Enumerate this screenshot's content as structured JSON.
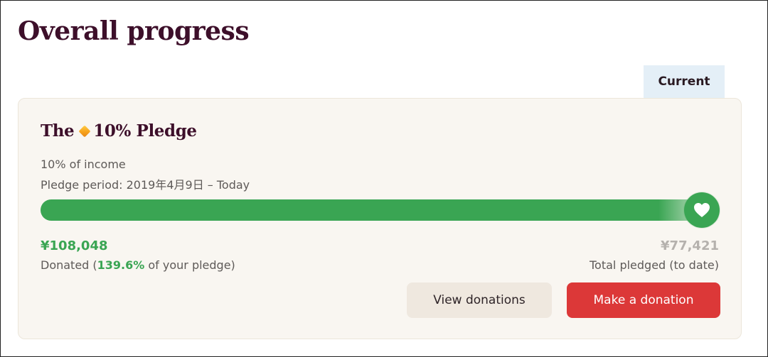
{
  "page": {
    "title": "Overall progress"
  },
  "tabs": {
    "current_label": "Current"
  },
  "pledge_card": {
    "title_prefix": "The",
    "title_icon": "diamond-icon",
    "title_suffix": "10% Pledge",
    "income_text": "10% of income",
    "period_text": "Pledge period: 2019年4月9日 – Today",
    "progress": {
      "percent_of_pledge": 139.6,
      "bar_fill_fraction": 1.0,
      "end_icon": "heart-icon"
    },
    "donated": {
      "amount": "¥108,048",
      "caption_prefix": "Donated (",
      "caption_percent": "139.6%",
      "caption_suffix": " of your pledge)"
    },
    "pledged": {
      "amount": "¥77,421",
      "caption": "Total pledged (to date)"
    },
    "buttons": {
      "view_label": "View donations",
      "make_label": "Make a donation"
    }
  },
  "colors": {
    "brand_title": "#3d0f2a",
    "progress_green": "#3aa553",
    "donate_red": "#dc3838",
    "tab_background": "#e4eff7",
    "card_background": "#f9f6f1",
    "muted_amount": "#b5b1ad"
  }
}
